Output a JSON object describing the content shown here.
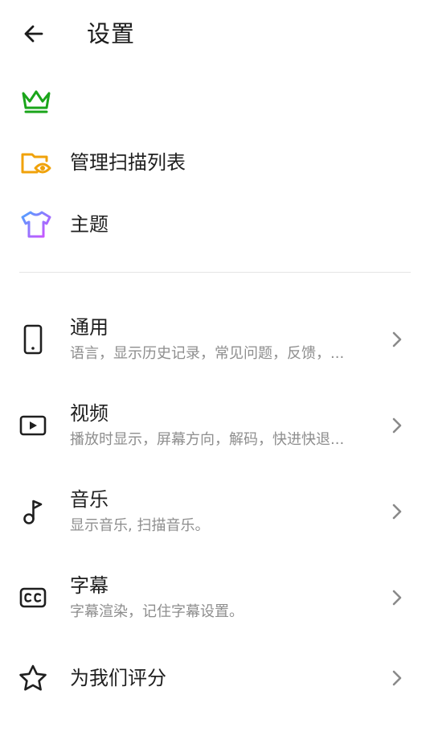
{
  "header": {
    "title": "设置",
    "back_icon": "arrow-left-icon"
  },
  "top_items": [
    {
      "label": "",
      "icon": "crown-icon",
      "color": "#1aa51a"
    },
    {
      "label": "管理扫描列表",
      "icon": "folder-eye-icon",
      "color": "#f0a20a"
    },
    {
      "label": "主题",
      "icon": "tshirt-icon",
      "color": "#9b5cf0"
    }
  ],
  "settings": [
    {
      "title": "通用",
      "subtitle": "语言，显示历史记录，常见问题，反馈，...",
      "icon": "phone-icon"
    },
    {
      "title": "视频",
      "subtitle": "播放时显示，屏幕方向，解码，快进快退...",
      "icon": "play-icon"
    },
    {
      "title": "音乐",
      "subtitle": "显示音乐, 扫描音乐。",
      "icon": "music-note-icon"
    },
    {
      "title": "字幕",
      "subtitle": "字幕渲染，记住字幕设置。",
      "icon": "cc-icon"
    }
  ],
  "rate": {
    "title": "为我们评分",
    "icon": "star-icon"
  },
  "colors": {
    "crown": "#1aa51a",
    "folder": "#f0a20a",
    "theme_gradient_start": "#4fa3ff",
    "theme_gradient_end": "#d64bff",
    "subtitle": "#8e8e8e",
    "divider": "#e4e4e4"
  }
}
